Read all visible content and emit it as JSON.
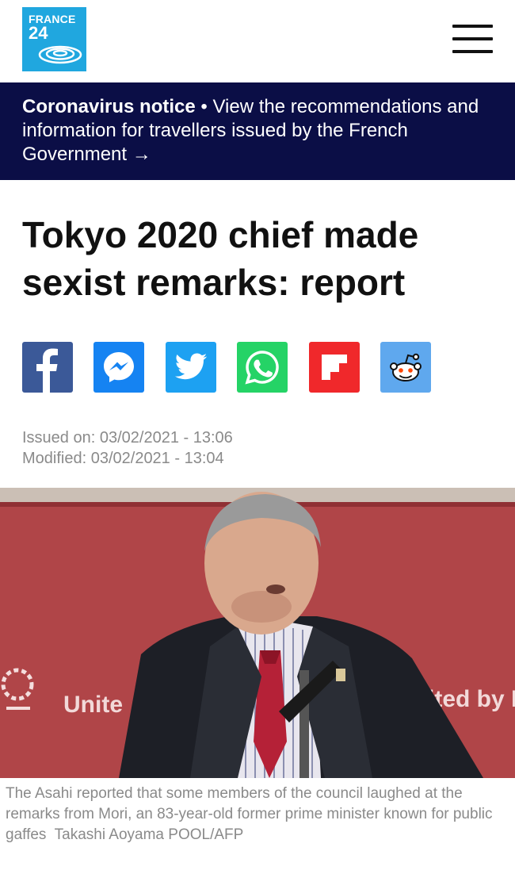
{
  "header": {
    "logo": {
      "line1": "FRANCE",
      "line2": "24",
      "brand_color": "#20a7df"
    },
    "menu_icon": "hamburger-menu-icon"
  },
  "notice": {
    "bold": "Coronavirus notice",
    "separator": " • ",
    "text": "View the recommendations and information for travellers issued by the French Government ",
    "arrow": "→",
    "background": "#0b0e46"
  },
  "article": {
    "title": "Tokyo 2020 chief made sexist remarks: report",
    "issued": "Issued on: 03/02/2021 - 13:06",
    "modified": "Modified: 03/02/2021 - 13:04",
    "caption": "The Asahi reported that some members of the council laughed at the remarks from Mori, an 83-year-old former prime minister known for public gaffes",
    "credit": "Takashi Aoyama POOL/AFP",
    "photo_banner_left": "Unite",
    "photo_banner_right": "ited by E"
  },
  "share": [
    {
      "network": "Facebook",
      "icon": "facebook-icon",
      "color": "#3b5998"
    },
    {
      "network": "Messenger",
      "icon": "messenger-icon",
      "color": "#1583f2"
    },
    {
      "network": "Twitter",
      "icon": "twitter-icon",
      "color": "#1da1f2"
    },
    {
      "network": "WhatsApp",
      "icon": "whatsapp-icon",
      "color": "#25d366"
    },
    {
      "network": "Flipboard",
      "icon": "flipboard-icon",
      "color": "#f0282b"
    },
    {
      "network": "Reddit",
      "icon": "reddit-icon",
      "color": "#5fa8ee"
    }
  ]
}
